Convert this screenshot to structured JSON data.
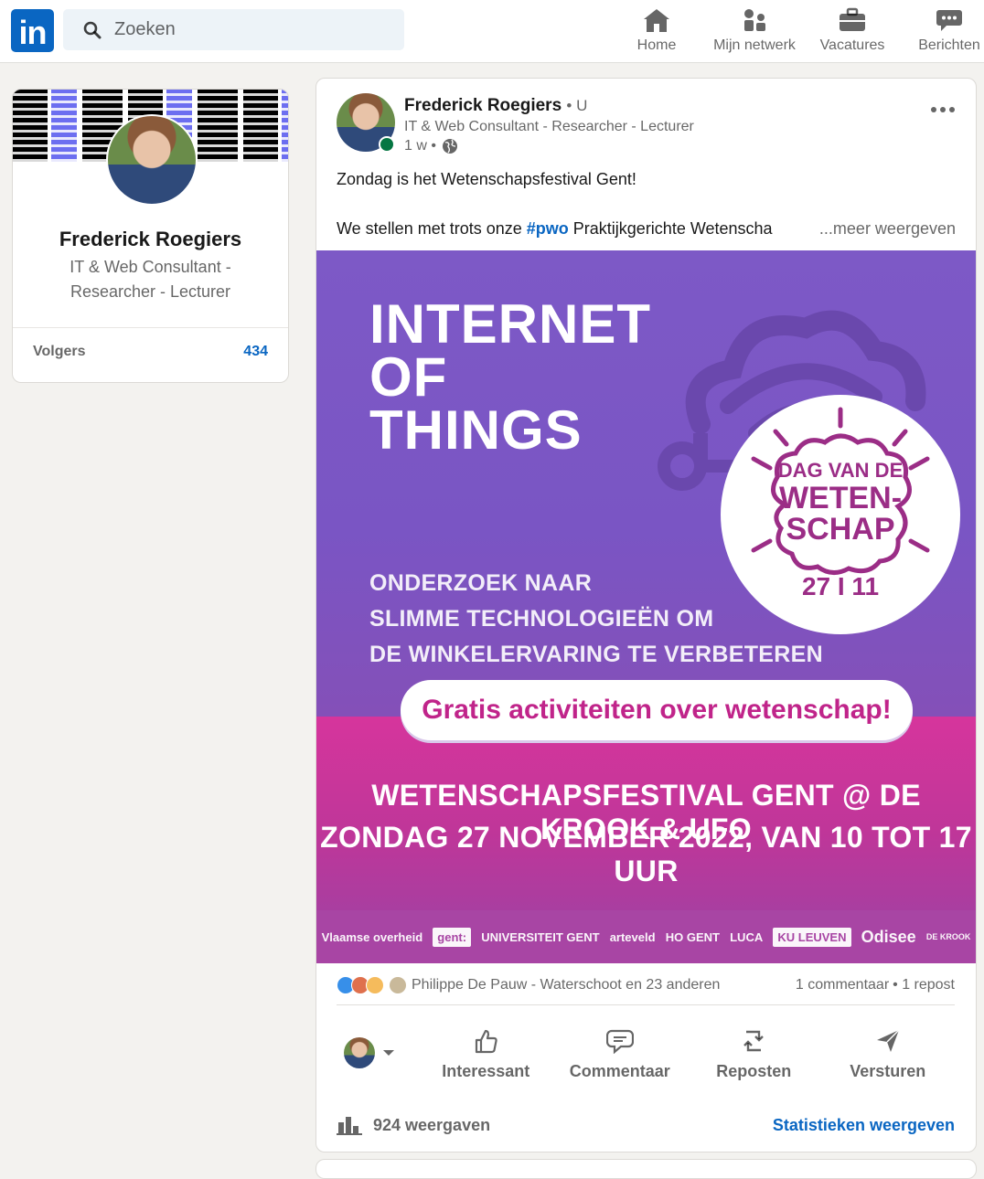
{
  "header": {
    "logo_text": "in",
    "search": {
      "placeholder": "Zoeken"
    },
    "nav": [
      {
        "label": "Home",
        "icon": "home-icon"
      },
      {
        "label": "Mijn netwerk",
        "icon": "network-icon"
      },
      {
        "label": "Vacatures",
        "icon": "briefcase-icon"
      },
      {
        "label": "Berichten",
        "icon": "messaging-icon"
      }
    ]
  },
  "profile": {
    "name": "Frederick Roegiers",
    "headline": "IT & Web Consultant - Researcher - Lecturer",
    "followers_label": "Volgers",
    "followers_count": "434"
  },
  "post": {
    "author": "Frederick Roegiers",
    "degree": "• U",
    "headline": "IT & Web Consultant - Researcher - Lecturer",
    "time": "1 w •",
    "text_line1": "Zondag is het Wetenschapsfestival Gent!",
    "text_line2_before": "We stellen met trots onze ",
    "hashtag": "#pwo",
    "text_line2_after": " Praktijkgerichte Wetenscha",
    "see_more": "...meer weergeven",
    "image": {
      "title_lines": [
        "INTERNET",
        "OF",
        "THINGS"
      ],
      "subtitle_lines": [
        "ONDERZOEK NAAR",
        "SLIMME TECHNOLOGIEËN OM",
        "DE WINKELERVARING TE VERBETEREN"
      ],
      "badge_lines": [
        "DAG VAN DE",
        "WETEN-",
        "SCHAP"
      ],
      "badge_date": "27 I 11",
      "pill_text": "Gratis activiteiten over wetenschap!",
      "festival_line1": "WETENSCHAPSFESTIVAL GENT @ DE KROOK & UFO",
      "festival_line2": "ZONDAG 27 NOVEMBER 2022, VAN 10 TOT 17 UUR",
      "partner_logos": [
        "Vlaamse overheid",
        "gent:",
        "UNIVERSITEIT GENT",
        "arteveld",
        "HO GENT",
        "LUCA",
        "KU LEUVEN",
        "Odisee",
        "DE KROOK"
      ],
      "colors": {
        "purple": "#7d59c6",
        "pink": "#d6359c",
        "magenta_text": "#c0248a"
      }
    },
    "social": {
      "reactors": "Philippe De Pauw - Waterschoot en 23 anderen",
      "comments": "1 commentaar",
      "reposts": "• 1 repost"
    },
    "actions": [
      {
        "label": "Interessant",
        "icon": "like-icon"
      },
      {
        "label": "Commentaar",
        "icon": "comment-icon"
      },
      {
        "label": "Reposten",
        "icon": "repost-icon"
      },
      {
        "label": "Versturen",
        "icon": "send-icon"
      }
    ],
    "views": "924 weergaven",
    "stats_link": "Statistieken weergeven"
  },
  "colors": {
    "brand": "#0a66c2",
    "background": "#f3f2ef",
    "online": "#057642"
  }
}
